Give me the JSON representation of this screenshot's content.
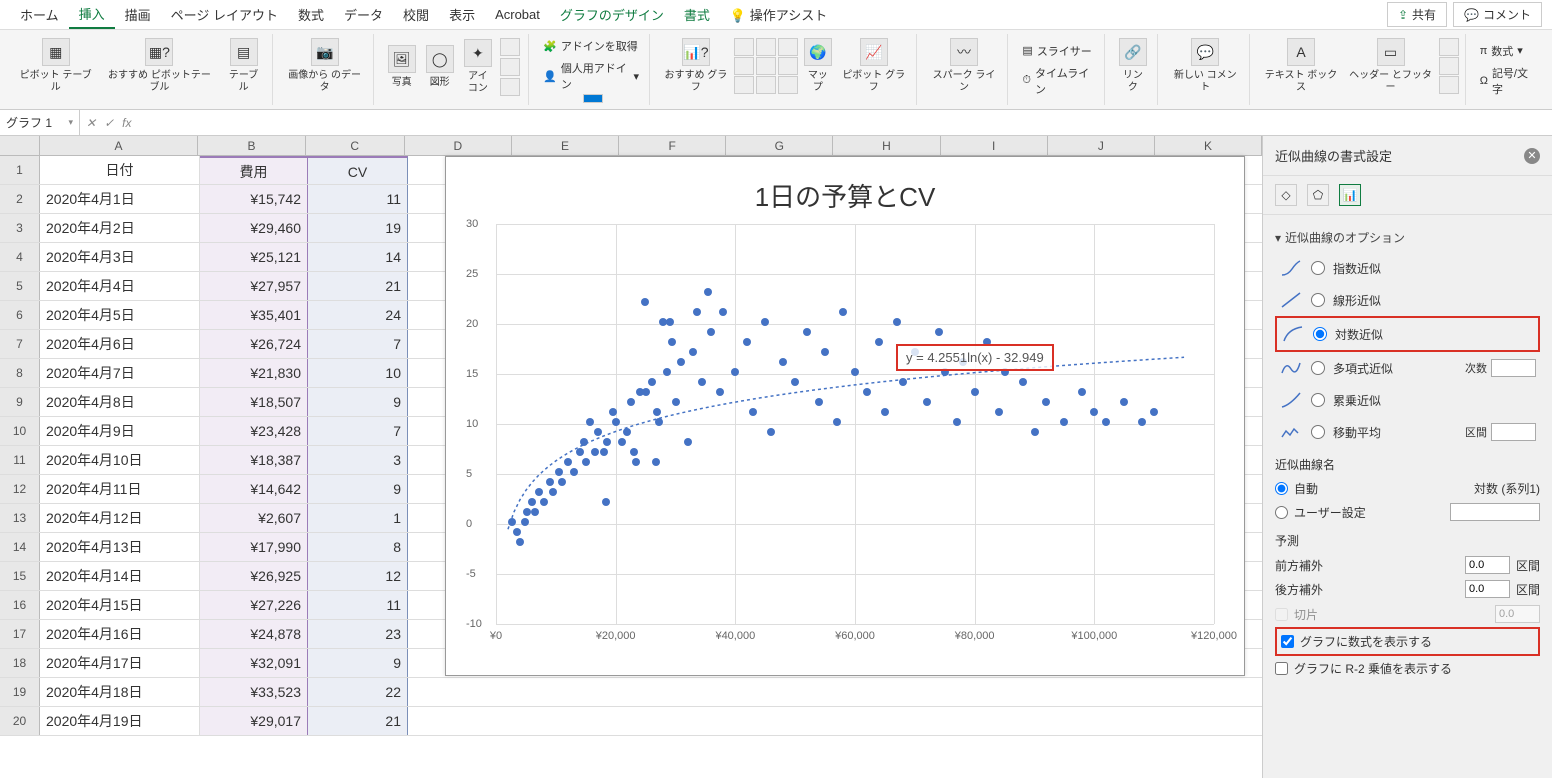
{
  "menu": {
    "tabs": [
      "ホーム",
      "挿入",
      "描画",
      "ページ レイアウト",
      "数式",
      "データ",
      "校閲",
      "表示",
      "Acrobat",
      "グラフのデザイン",
      "書式"
    ],
    "active": "挿入",
    "assist": "操作アシスト",
    "share": "共有",
    "comment": "コメント"
  },
  "ribbon": {
    "pivot": "ピボット\nテーブル",
    "rec_pivot": "おすすめ\nピボットテーブル",
    "table": "テーブル",
    "image_from": "画像から\nのデータ",
    "picture": "写真",
    "shapes": "図形",
    "icons": "アイコン",
    "addin_get": "アドインを取得",
    "addin_my": "個人用アドイン",
    "rec_chart": "おすすめ\nグラフ",
    "map": "マップ",
    "pivot_chart": "ピボット\nグラフ",
    "sparkline": "スパーク\nライン",
    "slicer": "スライサー",
    "timeline": "タイムライン",
    "link": "リンク",
    "comment_new": "新しい\nコメント",
    "textbox": "テキスト\nボックス",
    "header_footer": "ヘッダー\nとフッター",
    "equation": "数式",
    "symbol": "記号/文字"
  },
  "formula_bar": {
    "name_box": "グラフ 1"
  },
  "columns": [
    "A",
    "B",
    "C",
    "D",
    "E",
    "F",
    "G",
    "H",
    "I",
    "J",
    "K"
  ],
  "table": {
    "headers": {
      "date": "日付",
      "cost": "費用",
      "cv": "CV"
    },
    "rows": [
      {
        "date": "2020年4月1日",
        "cost": "¥15,742",
        "cv": "11"
      },
      {
        "date": "2020年4月2日",
        "cost": "¥29,460",
        "cv": "19"
      },
      {
        "date": "2020年4月3日",
        "cost": "¥25,121",
        "cv": "14"
      },
      {
        "date": "2020年4月4日",
        "cost": "¥27,957",
        "cv": "21"
      },
      {
        "date": "2020年4月5日",
        "cost": "¥35,401",
        "cv": "24"
      },
      {
        "date": "2020年4月6日",
        "cost": "¥26,724",
        "cv": "7"
      },
      {
        "date": "2020年4月7日",
        "cost": "¥21,830",
        "cv": "10"
      },
      {
        "date": "2020年4月8日",
        "cost": "¥18,507",
        "cv": "9"
      },
      {
        "date": "2020年4月9日",
        "cost": "¥23,428",
        "cv": "7"
      },
      {
        "date": "2020年4月10日",
        "cost": "¥18,387",
        "cv": "3"
      },
      {
        "date": "2020年4月11日",
        "cost": "¥14,642",
        "cv": "9"
      },
      {
        "date": "2020年4月12日",
        "cost": "¥2,607",
        "cv": "1"
      },
      {
        "date": "2020年4月13日",
        "cost": "¥17,990",
        "cv": "8"
      },
      {
        "date": "2020年4月14日",
        "cost": "¥26,925",
        "cv": "12"
      },
      {
        "date": "2020年4月15日",
        "cost": "¥27,226",
        "cv": "11"
      },
      {
        "date": "2020年4月16日",
        "cost": "¥24,878",
        "cv": "23"
      },
      {
        "date": "2020年4月17日",
        "cost": "¥32,091",
        "cv": "9"
      },
      {
        "date": "2020年4月18日",
        "cost": "¥33,523",
        "cv": "22"
      },
      {
        "date": "2020年4月19日",
        "cost": "¥29,017",
        "cv": "21"
      }
    ]
  },
  "chart_data": {
    "type": "scatter",
    "title": "1日の予算とCV",
    "xlabel": "",
    "ylabel": "",
    "xlim": [
      0,
      120000
    ],
    "ylim": [
      -10,
      30
    ],
    "x_ticks": [
      "¥0",
      "¥20,000",
      "¥40,000",
      "¥60,000",
      "¥80,000",
      "¥100,000",
      "¥120,000"
    ],
    "y_ticks": [
      -10,
      -5,
      0,
      5,
      10,
      15,
      20,
      25,
      30
    ],
    "trend_equation": "y = 4.2551ln(x) - 32.949",
    "series": [
      {
        "name": "対数 (系列1)",
        "approx_points": [
          [
            2607,
            1
          ],
          [
            3500,
            0
          ],
          [
            4000,
            -1
          ],
          [
            4800,
            1
          ],
          [
            5200,
            2
          ],
          [
            6000,
            3
          ],
          [
            6500,
            2
          ],
          [
            7200,
            4
          ],
          [
            8000,
            3
          ],
          [
            9000,
            5
          ],
          [
            9500,
            4
          ],
          [
            10500,
            6
          ],
          [
            11000,
            5
          ],
          [
            12000,
            7
          ],
          [
            13000,
            6
          ],
          [
            14000,
            8
          ],
          [
            14642,
            9
          ],
          [
            15000,
            7
          ],
          [
            15742,
            11
          ],
          [
            16500,
            8
          ],
          [
            17000,
            10
          ],
          [
            17990,
            8
          ],
          [
            18387,
            3
          ],
          [
            18507,
            9
          ],
          [
            19500,
            12
          ],
          [
            20000,
            11
          ],
          [
            21000,
            9
          ],
          [
            21830,
            10
          ],
          [
            22500,
            13
          ],
          [
            23000,
            8
          ],
          [
            23428,
            7
          ],
          [
            24000,
            14
          ],
          [
            24878,
            23
          ],
          [
            25121,
            14
          ],
          [
            26000,
            15
          ],
          [
            26724,
            7
          ],
          [
            26925,
            12
          ],
          [
            27226,
            11
          ],
          [
            27957,
            21
          ],
          [
            28500,
            16
          ],
          [
            29017,
            21
          ],
          [
            29460,
            19
          ],
          [
            30000,
            13
          ],
          [
            31000,
            17
          ],
          [
            32091,
            9
          ],
          [
            33000,
            18
          ],
          [
            33523,
            22
          ],
          [
            34500,
            15
          ],
          [
            35401,
            24
          ],
          [
            36000,
            20
          ],
          [
            37500,
            14
          ],
          [
            38000,
            22
          ],
          [
            40000,
            16
          ],
          [
            42000,
            19
          ],
          [
            43000,
            12
          ],
          [
            45000,
            21
          ],
          [
            46000,
            10
          ],
          [
            48000,
            17
          ],
          [
            50000,
            15
          ],
          [
            52000,
            20
          ],
          [
            54000,
            13
          ],
          [
            55000,
            18
          ],
          [
            57000,
            11
          ],
          [
            58000,
            22
          ],
          [
            60000,
            16
          ],
          [
            62000,
            14
          ],
          [
            64000,
            19
          ],
          [
            65000,
            12
          ],
          [
            67000,
            21
          ],
          [
            68000,
            15
          ],
          [
            70000,
            18
          ],
          [
            72000,
            13
          ],
          [
            74000,
            20
          ],
          [
            75000,
            16
          ],
          [
            77000,
            11
          ],
          [
            78000,
            17
          ],
          [
            80000,
            14
          ],
          [
            82000,
            19
          ],
          [
            84000,
            12
          ],
          [
            85000,
            16
          ],
          [
            88000,
            15
          ],
          [
            90000,
            10
          ],
          [
            92000,
            13
          ],
          [
            95000,
            11
          ],
          [
            98000,
            14
          ],
          [
            100000,
            12
          ],
          [
            102000,
            11
          ],
          [
            105000,
            13
          ],
          [
            108000,
            11
          ],
          [
            110000,
            12
          ]
        ]
      }
    ]
  },
  "panel": {
    "title": "近似曲線の書式設定",
    "section": "近似曲線のオプション",
    "options": {
      "exp": "指数近似",
      "linear": "線形近似",
      "log": "対数近似",
      "poly": "多項式近似",
      "power": "累乗近似",
      "mavg": "移動平均"
    },
    "poly_degree_label": "次数",
    "mavg_period_label": "区間",
    "name_head": "近似曲線名",
    "name_auto": "自動",
    "name_auto_val": "対数 (系列1)",
    "name_custom": "ユーザー設定",
    "forecast_head": "予測",
    "fwd": "前方補外",
    "bwd": "後方補外",
    "fwd_val": "0.0",
    "bwd_val": "0.0",
    "period": "区間",
    "intercept": "切片",
    "intercept_val": "0.0",
    "show_eq": "グラフに数式を表示する",
    "show_r2": "グラフに R-2 乗値を表示する"
  }
}
